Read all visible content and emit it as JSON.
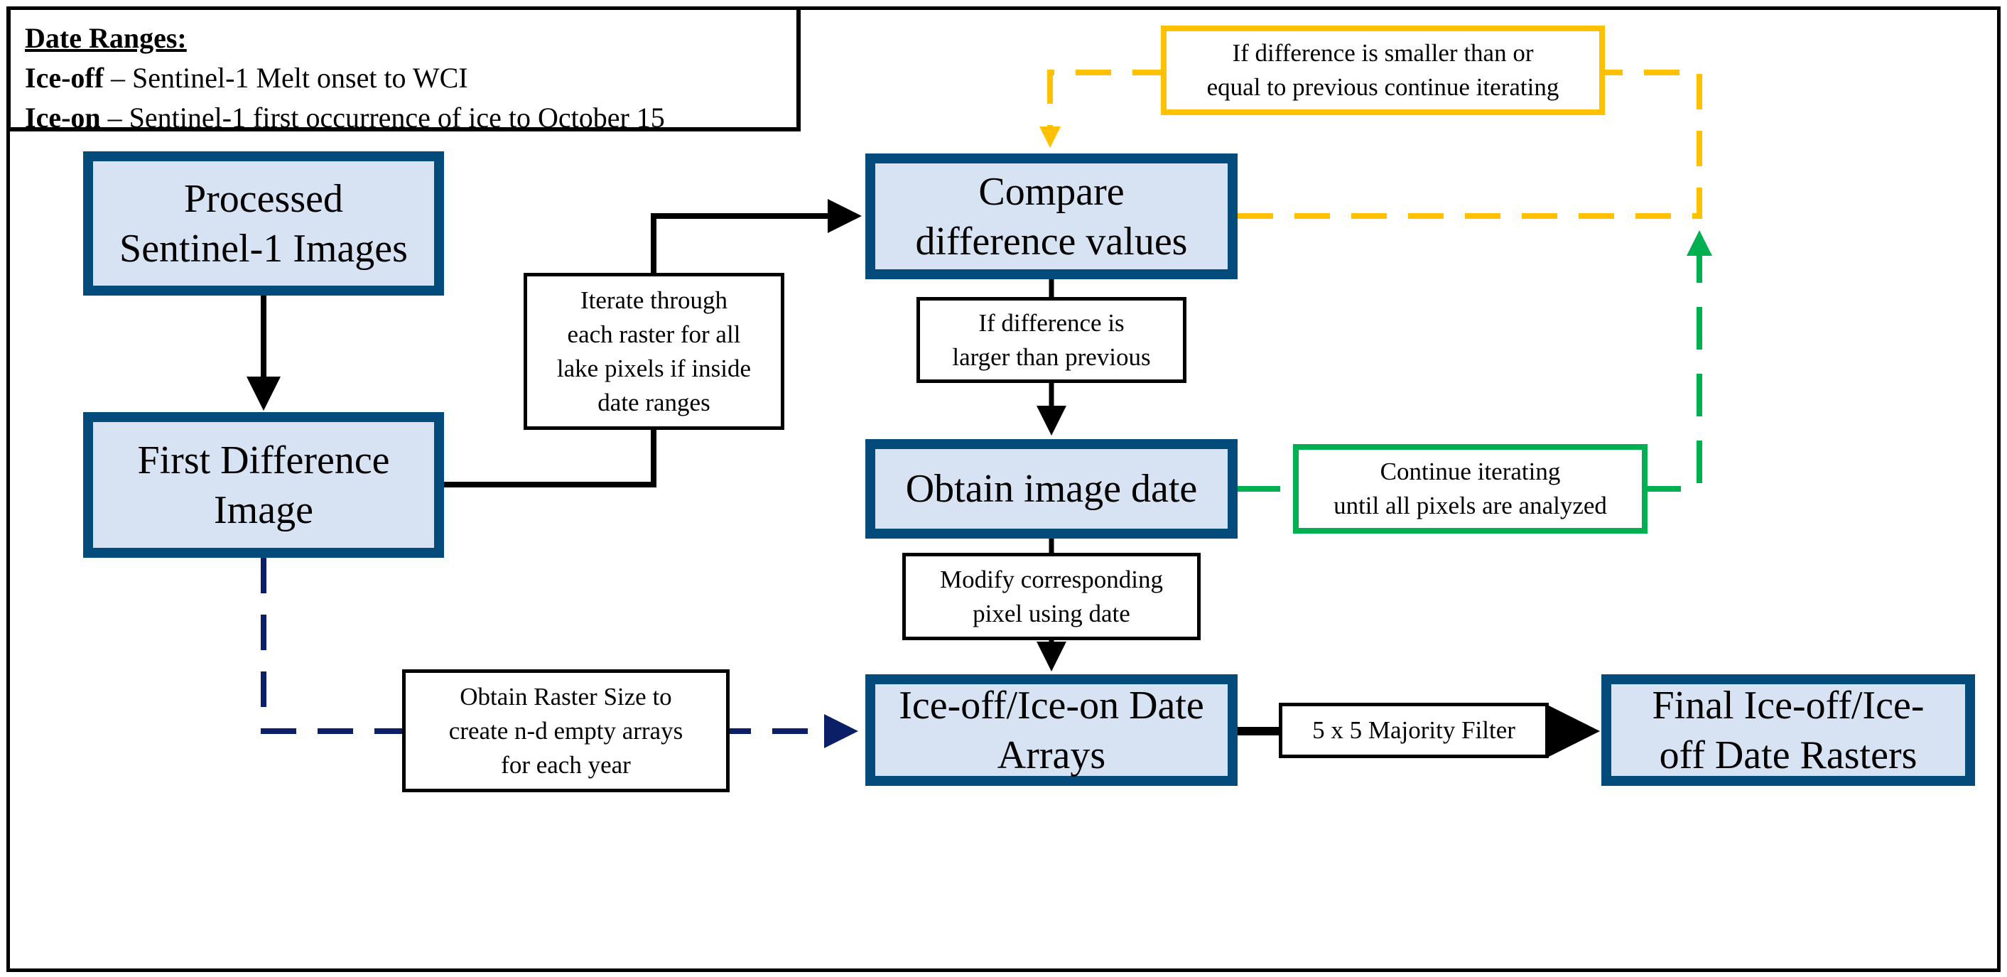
{
  "legend": {
    "title": "Date Ranges:",
    "rows": [
      {
        "term": "Ice-off",
        "desc": " – Sentinel-1 Melt onset to WCI"
      },
      {
        "term": "Ice-on",
        "desc": " – Sentinel-1 first occurrence of ice to October 15"
      }
    ]
  },
  "nodes": {
    "processed": "Processed\nSentinel-1 Images",
    "first_difference": "First Difference\nImage",
    "compare": "Compare\ndifference values",
    "obtain_date": "Obtain image date",
    "ice_arrays": "Ice-off/Ice-on Date\nArrays",
    "final_rasters": "Final Ice-off/Ice-\noff Date Rasters"
  },
  "labels": {
    "iterate": "Iterate through\neach raster for all\nlake pixels if inside\ndate ranges",
    "if_larger": "If difference is\nlarger than previous",
    "modify_pixel": "Modify corresponding\npixel using date",
    "raster_size": "Obtain Raster Size to\ncreate n-d empty arrays\nfor each year",
    "majority_filter": "5 x 5 Majority Filter",
    "if_smaller": "If difference is smaller than or\nequal to previous continue iterating",
    "continue_iterating": "Continue iterating\nuntil all pixels are analyzed"
  },
  "colors": {
    "node_fill": "#d7e3f3",
    "node_border": "#024b7a",
    "flow_black": "#000000",
    "loop_yellow": "#ffc000",
    "loop_green": "#00b050",
    "init_navy": "#0a1f66"
  }
}
